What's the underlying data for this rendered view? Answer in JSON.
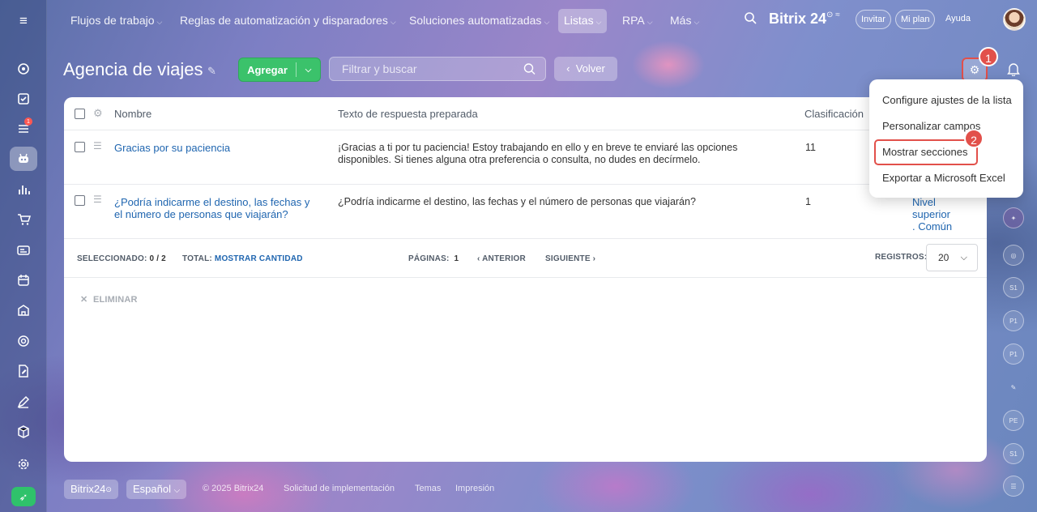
{
  "topnav": {
    "items": [
      {
        "label": "Flujos de trabajo"
      },
      {
        "label": "Reglas de automatización y disparadores"
      },
      {
        "label": "Soluciones automatizadas"
      },
      {
        "label": "Listas"
      },
      {
        "label": "RPA"
      },
      {
        "label": "Más"
      }
    ],
    "brand": "Bitrix 24",
    "invite": "Invitar",
    "plan": "Mi plan",
    "help": "Ayuda"
  },
  "left_rail": {
    "tasks_badge": "1"
  },
  "page": {
    "title": "Agencia de viajes",
    "add_label": "Agregar",
    "filter_placeholder": "Filtrar y buscar",
    "back_label": "Volver",
    "steps": {
      "one": "1",
      "two": "2"
    }
  },
  "table": {
    "headers": {
      "name": "Nombre",
      "text": "Texto de respuesta preparada",
      "rank": "Clasificación"
    },
    "rows": [
      {
        "name": "Gracias por su paciencia",
        "text_line1": "¡Gracias a ti por tu paciencia! Estoy trabajando en ello y en breve te enviaré las opciones",
        "text_line2": "disponibles. Si tienes alguna otra preferencia o consulta, no dudes en decírmelo.",
        "rank": "11"
      },
      {
        "name_line1": "¿Podría indicarme el destino, las fechas y",
        "name_line2": "el número de personas que viajarán?",
        "text": "¿Podría indicarme el destino, las fechas y el número de personas que viajarán?",
        "rank": "1",
        "section_line1": "Nivel",
        "section_line2": "superior",
        "section_line3": ". Común"
      }
    ],
    "footer": {
      "selected_label": "SELECCIONADO:",
      "selected_value": "0 / 2",
      "total_label": "TOTAL:",
      "total_link": "MOSTRAR CANTIDAD",
      "pages_label": "PÁGINAS:",
      "pages_value": "1",
      "prev": "ANTERIOR",
      "next": "SIGUIENTE",
      "records_label": "REGISTROS:",
      "records_value": "20"
    },
    "delete_label": "ELIMINAR"
  },
  "menu": {
    "items": [
      {
        "label": "Configure ajustes de la lista"
      },
      {
        "label": "Personalizar campos"
      },
      {
        "label": "Mostrar secciones"
      },
      {
        "label": "Exportar a Microsoft Excel"
      }
    ]
  },
  "right_rail": {
    "avatars": [
      "S1",
      "P1",
      "P1",
      "PE",
      "S1"
    ]
  },
  "footer": {
    "brand": "Bitrix24",
    "language": "Español",
    "copyright": "© 2025 Bitrix24",
    "links": [
      "Solicitud de implementación",
      "Temas",
      "Impresión"
    ]
  },
  "colors": {
    "accent_green": "#3bc26b",
    "link_blue": "#2066b0",
    "highlight_red": "#e2504a"
  }
}
